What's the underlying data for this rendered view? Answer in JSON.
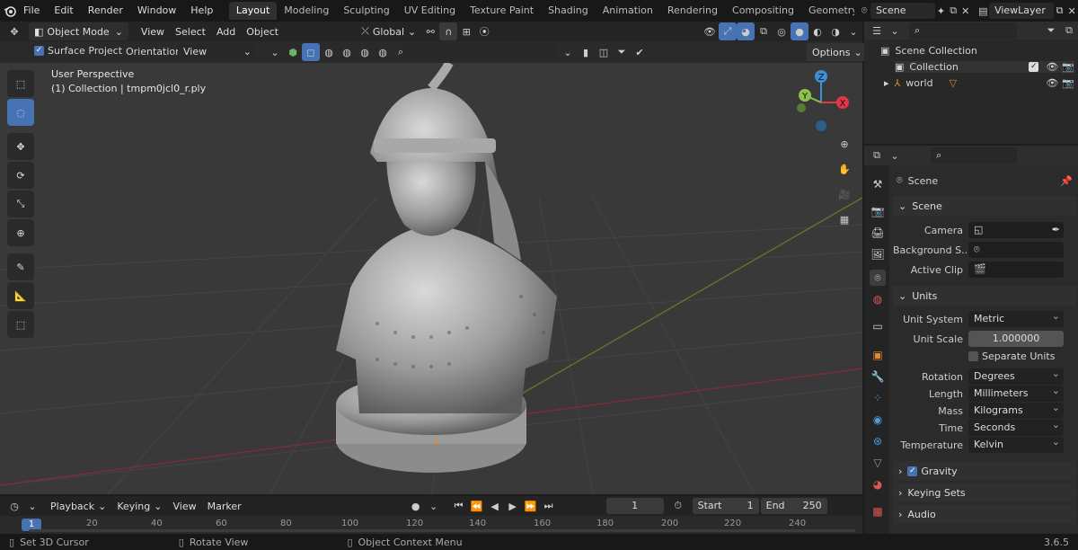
{
  "menubar": {
    "items": [
      "File",
      "Edit",
      "Render",
      "Window",
      "Help"
    ],
    "workspaces": [
      "Layout",
      "Modeling",
      "Sculpting",
      "UV Editing",
      "Texture Paint",
      "Shading",
      "Animation",
      "Rendering",
      "Compositing",
      "Geometry Noc"
    ],
    "active_workspace": "Layout",
    "scene": "Scene",
    "view_layer": "ViewLayer"
  },
  "viewport_header": {
    "mode": "Object Mode",
    "menus": [
      "View",
      "Select",
      "Add",
      "Object"
    ],
    "transform_orientation": "Global"
  },
  "tool_settings": {
    "surface_project": "Surface Project",
    "orientation_label": "Orientation:",
    "orientation_value": "View",
    "options": "Options"
  },
  "viewport": {
    "title": "User Perspective",
    "subtitle": "(1) Collection | tmpm0jcl0_r.ply",
    "gizmo": {
      "z": "Z",
      "y": "Y",
      "x": "X"
    }
  },
  "outliner": {
    "root": "Scene Collection",
    "collection": "Collection",
    "object": "world"
  },
  "properties": {
    "context": "Scene",
    "panels": {
      "scene": {
        "title": "Scene",
        "camera_label": "Camera",
        "background_label": "Background S...",
        "clip_label": "Active Clip"
      },
      "units": {
        "title": "Units",
        "unit_system_label": "Unit System",
        "unit_system": "Metric",
        "unit_scale_label": "Unit Scale",
        "unit_scale": "1.000000",
        "separate_units": "Separate Units",
        "rotation_label": "Rotation",
        "rotation": "Degrees",
        "length_label": "Length",
        "length": "Millimeters",
        "mass_label": "Mass",
        "mass": "Kilograms",
        "time_label": "Time",
        "time": "Seconds",
        "temperature_label": "Temperature",
        "temperature": "Kelvin"
      },
      "gravity": "Gravity",
      "keying_sets": "Keying Sets",
      "audio": "Audio"
    }
  },
  "timeline": {
    "menus": [
      "Playback",
      "Keying",
      "View",
      "Marker"
    ],
    "current_frame": "1",
    "start_label": "Start",
    "start": "1",
    "end_label": "End",
    "end": "250",
    "ticks": [
      "1",
      "20",
      "40",
      "60",
      "80",
      "100",
      "120",
      "140",
      "160",
      "180",
      "200",
      "220",
      "240"
    ]
  },
  "statusbar": {
    "left": "Set 3D Cursor",
    "middle": "Rotate View",
    "right": "Object Context Menu",
    "version": "3.6.5"
  },
  "colors": {
    "accent": "#4772b3",
    "x_axis": "#e2374b",
    "y_axis": "#8bc34a",
    "z_axis": "#3b8fd6",
    "header": "#181818"
  }
}
